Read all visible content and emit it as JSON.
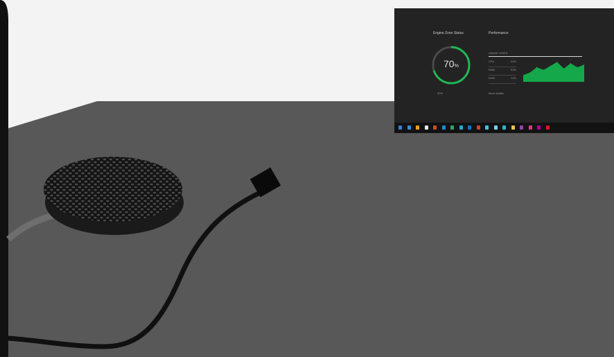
{
  "scene": {
    "description_items": [
      "table-surface",
      "speaker-grille",
      "cables",
      "monitor"
    ]
  },
  "monitor": {
    "storage": {
      "title": "Engine Zone Status",
      "percent_value": 0.7,
      "percent_label": "70",
      "percent_suffix": "%",
      "footer": "30%"
    },
    "performance": {
      "title": "Performance",
      "list_header": "USAGE STATS",
      "rows": [
        {
          "label": "CPU",
          "value": "24%"
        },
        {
          "label": "RAM",
          "value": "52%"
        },
        {
          "label": "DISK",
          "value": "11%"
        }
      ],
      "link": "More details"
    },
    "chart_data": {
      "type": "area",
      "x": [
        0,
        1,
        2,
        3,
        4,
        5,
        6,
        7,
        8,
        9
      ],
      "values": [
        10,
        14,
        22,
        18,
        24,
        30,
        20,
        28,
        22,
        26
      ],
      "ylim": [
        0,
        40
      ],
      "color": "#15a84a"
    },
    "taskbar_colors": [
      "#3a7bd5",
      "#2b8fe0",
      "#e8a317",
      "#e8e8e8",
      "#d24b2b",
      "#1d8bd1",
      "#38a169",
      "#26a8d8",
      "#0078d4",
      "#c74634",
      "#48c0e8",
      "#7cd1f0",
      "#2ab7ca",
      "#f0c24b",
      "#8e44ad",
      "#d83b7d",
      "#b4009e",
      "#e81123"
    ]
  }
}
